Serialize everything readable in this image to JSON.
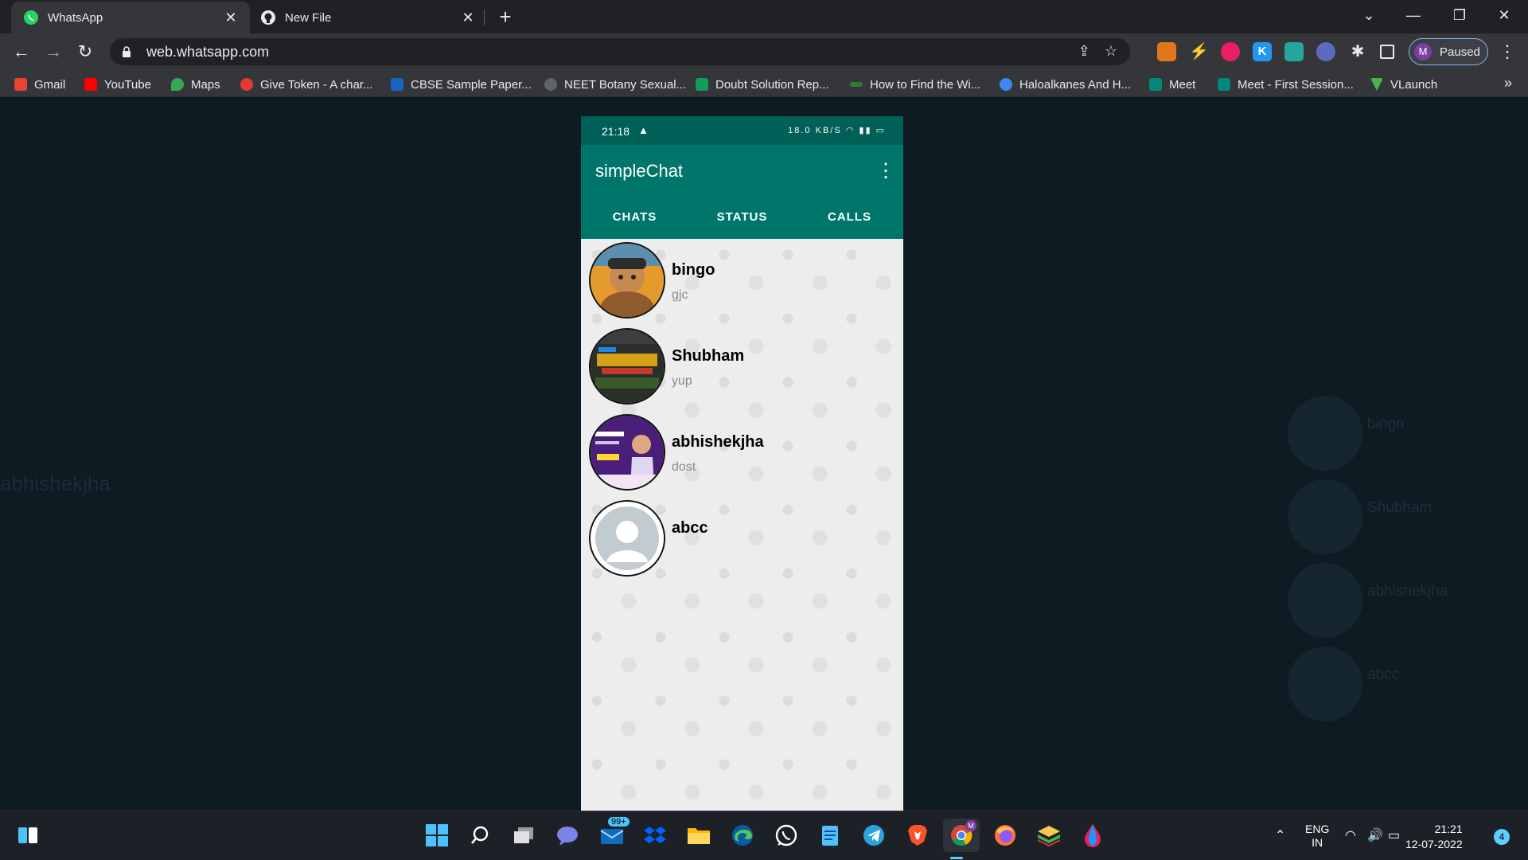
{
  "browser": {
    "tabs": [
      {
        "title": "WhatsApp",
        "icon": "whatsapp-icon",
        "active": true
      },
      {
        "title": "New File",
        "icon": "github-icon",
        "active": false
      }
    ],
    "url": "web.whatsapp.com",
    "profile_initial": "M",
    "profile_status": "Paused",
    "bookmarks": [
      {
        "label": "Gmail",
        "icon": "gmail-icon",
        "color": "#ea4335"
      },
      {
        "label": "YouTube",
        "icon": "youtube-icon",
        "color": "#ff0000"
      },
      {
        "label": "Maps",
        "icon": "maps-icon",
        "color": "#34a853"
      },
      {
        "label": "Give Token - A char...",
        "icon": "give-token-icon",
        "color": "#e53935"
      },
      {
        "label": "CBSE Sample Paper...",
        "icon": "cbse-icon",
        "color": "#1565c0"
      },
      {
        "label": "NEET Botany Sexual...",
        "icon": "neet-icon",
        "color": "#5f6368"
      },
      {
        "label": "Doubt Solution Rep...",
        "icon": "doubt-icon",
        "color": "#0f9d58"
      },
      {
        "label": "How to Find the Wi...",
        "icon": "link-icon",
        "color": "#2e7d32"
      },
      {
        "label": "Haloalkanes And H...",
        "icon": "upload-icon",
        "color": "#4285f4"
      },
      {
        "label": "Meet",
        "icon": "meet-icon",
        "color": "#00897b"
      },
      {
        "label": "Meet - First Session...",
        "icon": "meet-icon",
        "color": "#00897b"
      },
      {
        "label": "VLaunch",
        "icon": "vlaunch-icon",
        "color": "#4caf50"
      }
    ],
    "bookmarks_more": "»"
  },
  "phone": {
    "status_time": "21:18",
    "status_speed": "18.0 KB/S",
    "app_title": "simpleChat",
    "tabs": [
      "CHATS",
      "STATUS",
      "CALLS"
    ],
    "chats": [
      {
        "name": "bingo",
        "last_message": "gjc"
      },
      {
        "name": "Shubham",
        "last_message": "yup"
      },
      {
        "name": "abhishekjha",
        "last_message": "dost"
      },
      {
        "name": "abcc",
        "last_message": ""
      }
    ]
  },
  "background": {
    "ghost_title": "abhishekjha",
    "ghost_names": [
      "bingo",
      "Shubham",
      "abhishekjha",
      "abcc"
    ]
  },
  "taskbar": {
    "mail_badge": "99+",
    "chrome_badge": "M",
    "lang_line1": "ENG",
    "lang_line2": "IN",
    "clock_time": "21:21",
    "clock_date": "12-07-2022",
    "notification_count": "4"
  }
}
